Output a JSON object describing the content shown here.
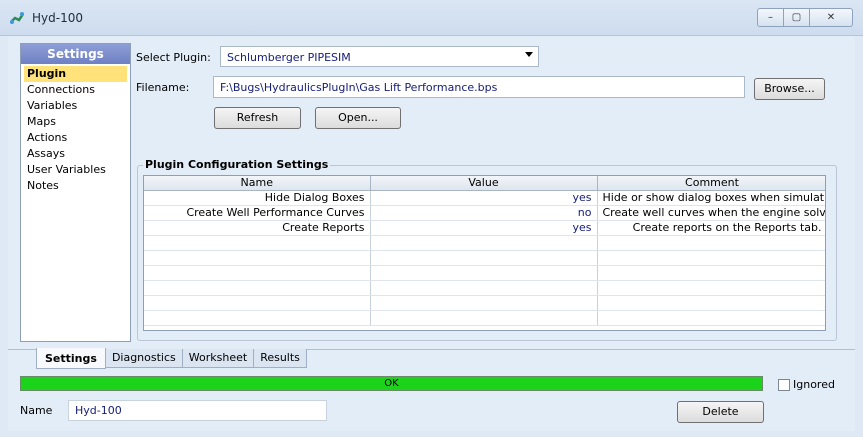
{
  "window": {
    "title": "Hyd-100",
    "minimize": "–",
    "restore": "▢",
    "close": "✕"
  },
  "nav": {
    "header": "Settings",
    "items": [
      "Plugin",
      "Connections",
      "Variables",
      "Maps",
      "Actions",
      "Assays",
      "User Variables",
      "Notes"
    ],
    "active": "Plugin"
  },
  "form": {
    "select_label": "Select Plugin:",
    "select_value": "Schlumberger PIPESIM",
    "filename_label": "Filename:",
    "filename_value": "F:\\Bugs\\HydraulicsPlugIn\\Gas Lift Performance.bps",
    "browse": "Browse...",
    "refresh": "Refresh",
    "open": "Open..."
  },
  "config": {
    "title": "Plugin Configuration Settings",
    "columns": [
      "Name",
      "Value",
      "Comment"
    ],
    "rows": [
      {
        "name": "Hide Dialog Boxes",
        "value": "yes",
        "comment": "Hide or show dialog boxes when simulati"
      },
      {
        "name": "Create Well Performance Curves",
        "value": "no",
        "comment": "Create well curves when the engine solves"
      },
      {
        "name": "Create Reports",
        "value": "yes",
        "comment": "Create reports on the Reports tab."
      }
    ]
  },
  "tabs": [
    "Settings",
    "Diagnostics",
    "Worksheet",
    "Results"
  ],
  "status": {
    "text": "OK",
    "color": "#1ad31a"
  },
  "ignored_label": "Ignored",
  "name_label": "Name",
  "name_value": "Hyd-100",
  "delete": "Delete",
  "icons": {
    "app": "pipe-segment-icon",
    "dropdown": "chevron-down-icon"
  }
}
